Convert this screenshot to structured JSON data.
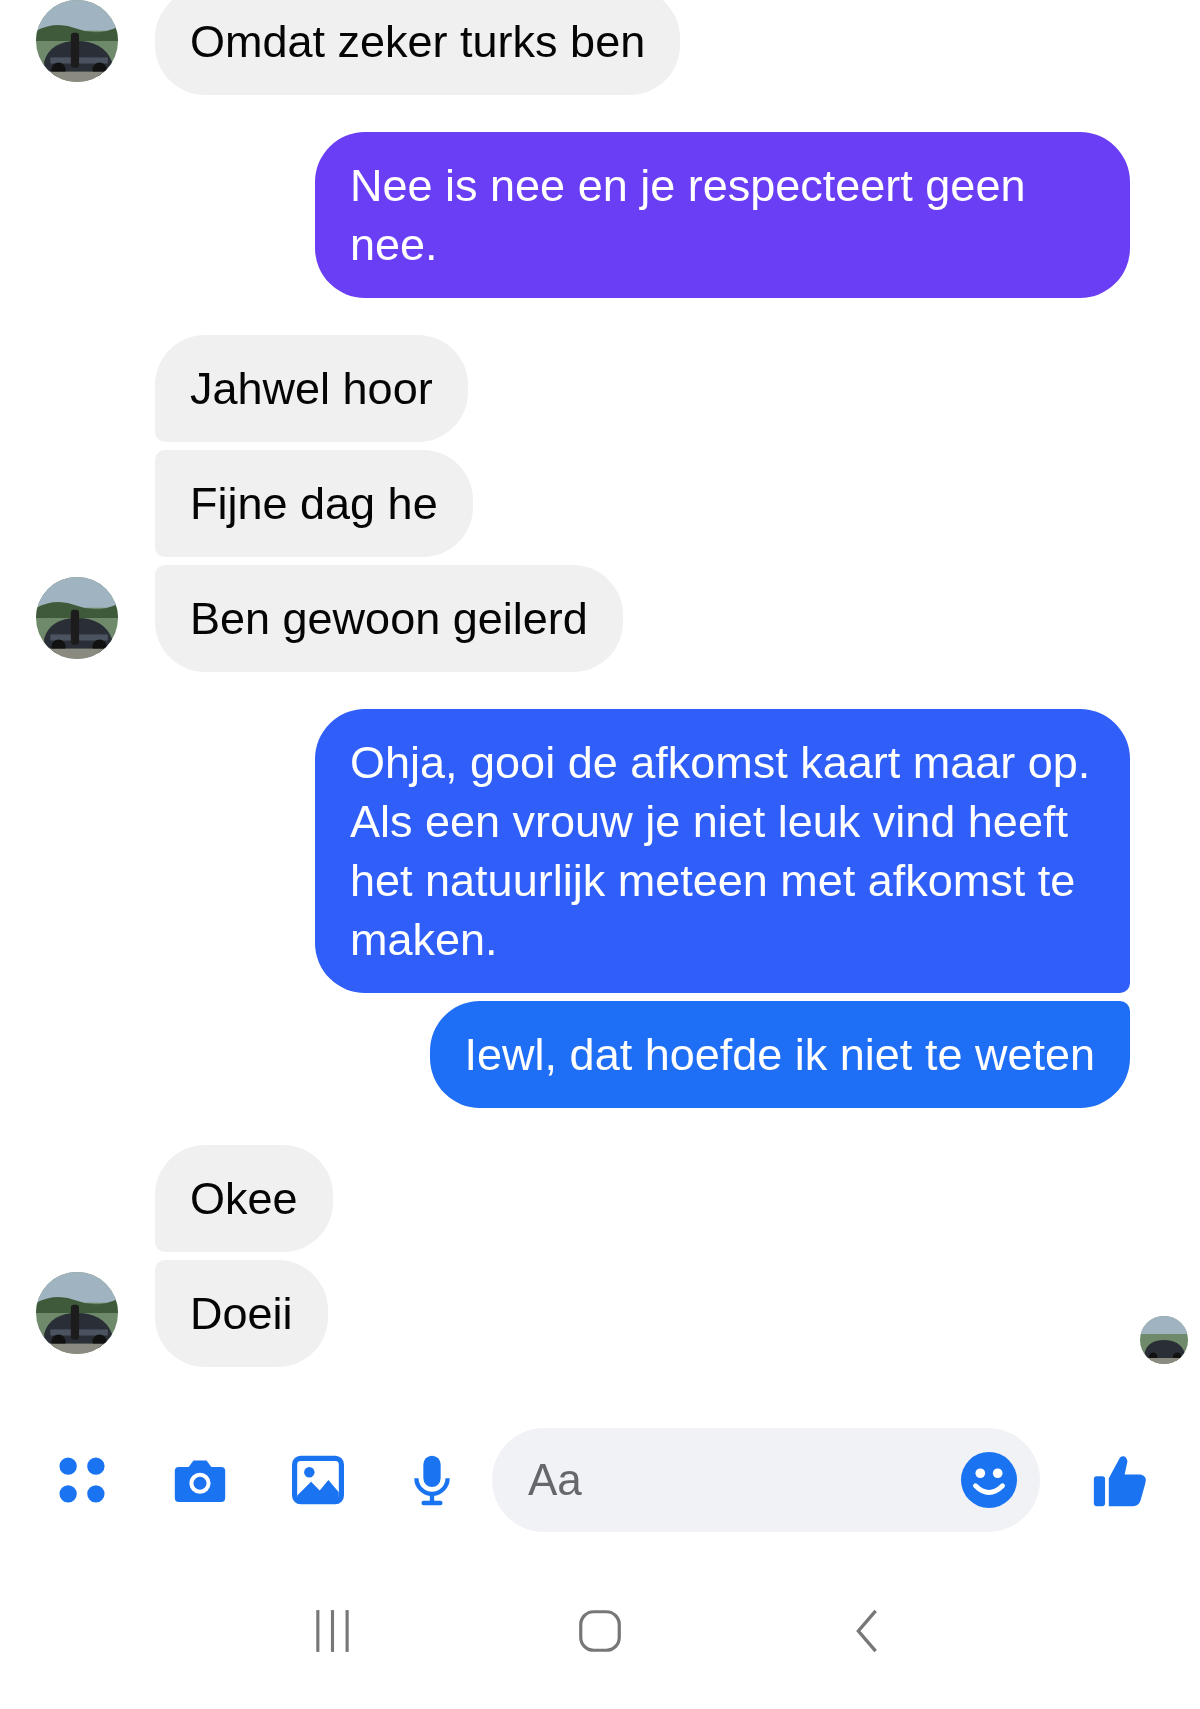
{
  "groups": [
    {
      "kind": "received",
      "messages": [
        {
          "text": "Omdat zeker turks ben"
        }
      ]
    },
    {
      "kind": "sent",
      "messages": [
        {
          "text": "Nee is nee en je respecteert geen nee.",
          "color": "#6a3ef5"
        }
      ]
    },
    {
      "kind": "received",
      "messages": [
        {
          "text": "Jahwel hoor"
        },
        {
          "text": "Fijne dag he"
        },
        {
          "text": "Ben gewoon geilerd"
        }
      ]
    },
    {
      "kind": "sent",
      "messages": [
        {
          "text": "Ohja, gooi de afkomst kaart maar op. Als een vrouw je niet leuk vind heeft het natuurlijk meteen met afkomst te maken.",
          "color": "#2f5ef8"
        },
        {
          "text": "Iewl, dat hoefde ik niet te weten",
          "color": "#1f6ef6"
        }
      ]
    },
    {
      "kind": "received",
      "messages": [
        {
          "text": "Okee"
        },
        {
          "text": "Doeii"
        }
      ]
    }
  ],
  "composer": {
    "placeholder": "Aa"
  }
}
